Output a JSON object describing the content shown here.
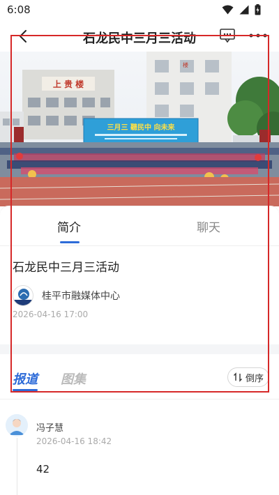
{
  "status_bar": {
    "time": "6:08"
  },
  "nav": {
    "title": "石龙民中三月三活动"
  },
  "tabs": [
    {
      "label": "简介",
      "active": true
    },
    {
      "label": "聊天",
      "active": false
    }
  ],
  "article": {
    "title": "石龙民中三月三活动",
    "source_name": "桂平市融媒体中心",
    "source_logo_text": "桂平融媒",
    "publish_time": "2026-04-16 17:00"
  },
  "hero": {
    "building_sign": "上 贵 楼",
    "banner_text": "三月三  聽民中  向未来"
  },
  "section_tabs": {
    "report": "报道",
    "gallery": "图集",
    "sort_label": "倒序"
  },
  "feed": [
    {
      "author": "冯子慧",
      "time": "2026-04-16 18:42",
      "body": "42"
    }
  ],
  "colors": {
    "accent": "#2d6bd8",
    "highlight": "#d62828"
  }
}
